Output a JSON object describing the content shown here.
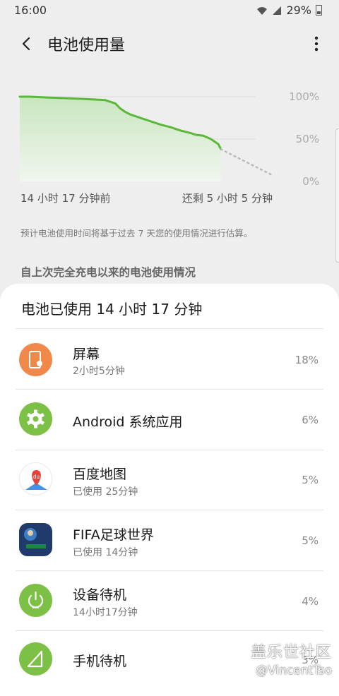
{
  "status": {
    "time": "16:00",
    "battery": "29%"
  },
  "app_bar": {
    "title": "电池使用量"
  },
  "chart_data": {
    "type": "line",
    "y_tick_labels": [
      "100%",
      "50%",
      "0%"
    ],
    "x_label_start": "14 小时 17 分钟前",
    "x_label_end": "还剩 5 小时 5 分钟",
    "ylim": [
      0,
      100
    ],
    "xlim": [
      0,
      1
    ],
    "grid": true,
    "series": [
      {
        "values_x": [
          0,
          0.04,
          0.12,
          0.2,
          0.28,
          0.34,
          0.38,
          0.4,
          0.42,
          0.44,
          0.5,
          0.56,
          0.6,
          0.64,
          0.68,
          0.7,
          0.73,
          0.76,
          0.79,
          0.8
        ],
        "values_y": [
          100,
          100,
          99,
          98,
          97,
          96,
          92,
          86,
          82,
          79,
          73,
          67,
          64,
          60,
          57,
          55,
          54,
          50,
          44,
          38
        ]
      },
      {
        "predicted": true,
        "values_x": [
          0.8,
          1.0
        ],
        "values_y": [
          38,
          8
        ]
      }
    ]
  },
  "estimate_note": "预计电池使用时间将基于过去 7 天您的使用情况进行估算。",
  "section_header": "自上次完全充电以来的电池使用情况",
  "card": {
    "title": "电池已使用 14 小时 17 分钟",
    "items": [
      {
        "name": "屏幕",
        "sub": "2小时5分钟",
        "pct": "18%",
        "icon": "screen-icon",
        "color": "#f0884a"
      },
      {
        "name": "Android 系统应用",
        "sub": "",
        "pct": "6%",
        "icon": "gear-icon",
        "color": "#7cc045"
      },
      {
        "name": "百度地图",
        "sub": "已使用 25分钟",
        "pct": "5%",
        "icon": "baidu-map-icon",
        "color": "#e6413b"
      },
      {
        "name": "FIFA足球世界",
        "sub": "已使用 14分钟",
        "pct": "5%",
        "icon": "fifa-icon",
        "color": "#1f3a6b"
      },
      {
        "name": "设备待机",
        "sub": "14小时17分钟",
        "pct": "4%",
        "icon": "power-icon",
        "color": "#7cc045"
      },
      {
        "name": "手机待机",
        "sub": "",
        "pct": "3%",
        "icon": "signal-icon",
        "color": "#7cc045"
      }
    ]
  },
  "watermark": {
    "title": "盖乐世社区",
    "sub": "@VincentTso"
  }
}
